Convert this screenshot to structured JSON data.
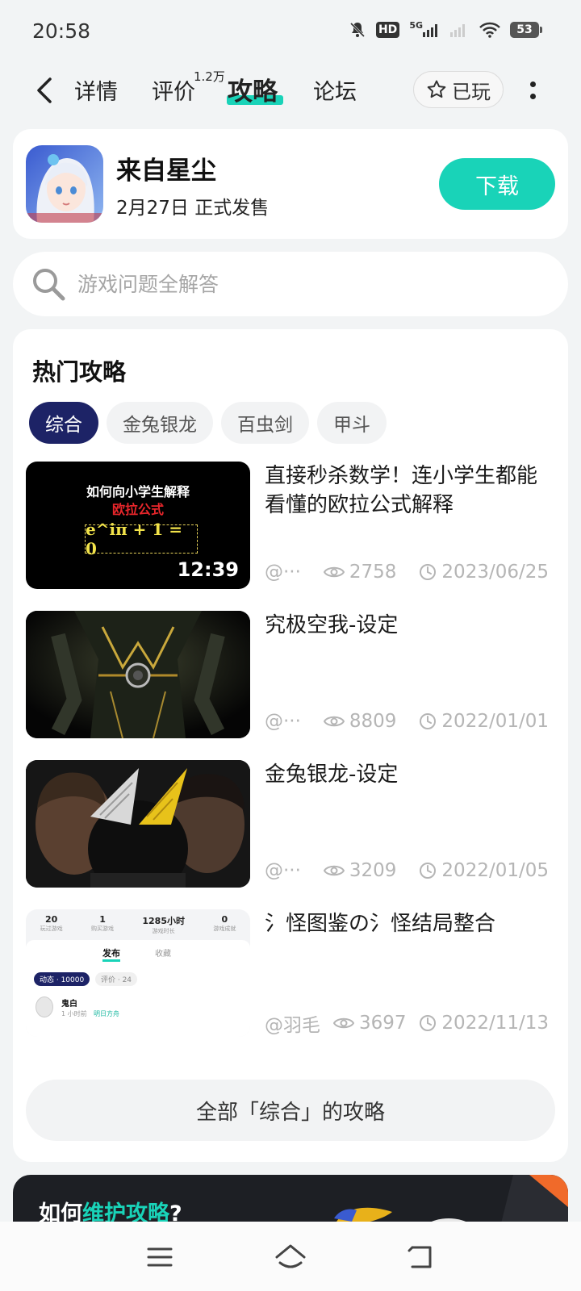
{
  "status": {
    "time": "20:58",
    "hd": "HD",
    "network": "5G",
    "battery": "53"
  },
  "nav": {
    "tabs": {
      "detail": "详情",
      "review": "评价",
      "guide": "攻略",
      "forum": "论坛"
    },
    "review_count": "1.2万",
    "played_label": "已玩"
  },
  "game": {
    "title": "来自星尘",
    "release": "2月27日 正式发售",
    "download_label": "下载"
  },
  "search": {
    "placeholder": "游戏问题全解答"
  },
  "hot": {
    "title": "热门攻略",
    "chips": [
      "综合",
      "金兔银龙",
      "百虫剑",
      "甲斗"
    ],
    "articles": [
      {
        "title": "直接秒杀数学！连小学生都能看懂的欧拉公式解释",
        "author": "@···",
        "views": "2758",
        "date": "2023/06/25",
        "thumb": {
          "line1": "如何向小学生解释",
          "line2": "欧拉公式",
          "formula": "e^iπ + 1 = 0",
          "duration": "12:39"
        }
      },
      {
        "title": "究极空我-设定",
        "author": "@···",
        "views": "8809",
        "date": "2022/01/01"
      },
      {
        "title": "金兔银龙-设定",
        "author": "@···",
        "views": "3209",
        "date": "2022/01/05"
      },
      {
        "title": "氵怪图鉴の氵怪结局整合",
        "author": "@羽毛",
        "views": "3697",
        "date": "2022/11/13",
        "thumb": {
          "stats": [
            {
              "num": "20",
              "label": "玩过游戏"
            },
            {
              "num": "1",
              "label": "购买游戏"
            },
            {
              "num": "1285小时",
              "label": "游戏时长"
            },
            {
              "num": "0",
              "label": "游戏成就"
            }
          ],
          "tab_active": "发布",
          "tab_other": "收藏",
          "pill_active": "动态 · 10000",
          "pill_other": "评价 · 24",
          "user_name": "鬼白",
          "user_time": "1 小时前",
          "user_game": "明日方舟"
        }
      }
    ],
    "all_label": "全部「综合」的攻略"
  },
  "banner": {
    "prefix": "如何",
    "highlight": "维护攻略",
    "suffix": "?"
  },
  "colors": {
    "accent": "#19d3b8",
    "chip_active": "#1d2366"
  }
}
